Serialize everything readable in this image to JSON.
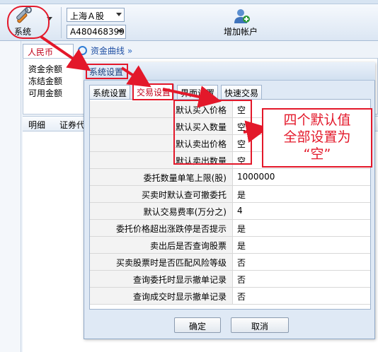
{
  "toolbar": {
    "system_label": "系统",
    "market_select": "上海Ａ股",
    "account_select": "A480468399",
    "add_account_label": "增加帐户"
  },
  "main": {
    "currency_tab": "人民币",
    "curve_tab": "资金曲线",
    "curve_suffix": "»",
    "fund_labels": [
      "资金余额",
      "冻结金额",
      "可用金额"
    ],
    "grid_headers": [
      "明细",
      "证券代"
    ]
  },
  "dialog": {
    "title": "系统设置",
    "tabs": [
      "系统设置",
      "交易设置",
      "界面设置",
      "快速交易"
    ],
    "active_tab": "交易设置",
    "settings": [
      {
        "label": "默认买入价格",
        "value": "空"
      },
      {
        "label": "默认买入数量",
        "value": "空"
      },
      {
        "label": "默认卖出价格",
        "value": "空"
      },
      {
        "label": "默认卖出数量",
        "value": "空"
      },
      {
        "label": "委托数量单笔上限(股)",
        "value": "1000000"
      },
      {
        "label": "买卖时默认查可撤委托",
        "value": "是"
      },
      {
        "label": "默认交易费率(万分之)",
        "value": "4"
      },
      {
        "label": "委托价格超出涨跌停是否提示",
        "value": "是"
      },
      {
        "label": "卖出后是否查询股票",
        "value": "是"
      },
      {
        "label": "买卖股票时是否匹配风险等级",
        "value": "否"
      },
      {
        "label": "查询委托时显示撤单记录",
        "value": "否"
      },
      {
        "label": "查询成交时显示撤单记录",
        "value": "否"
      }
    ],
    "ok_label": "确定",
    "cancel_label": "取消"
  },
  "annotation": {
    "callout_lines": [
      "四个默认值",
      "全部设置为",
      "“空”"
    ],
    "color": "#e3182a"
  },
  "icons": {
    "system": "tools-icon",
    "add_account": "add-user-icon",
    "curve": "chart-circle-icon"
  }
}
